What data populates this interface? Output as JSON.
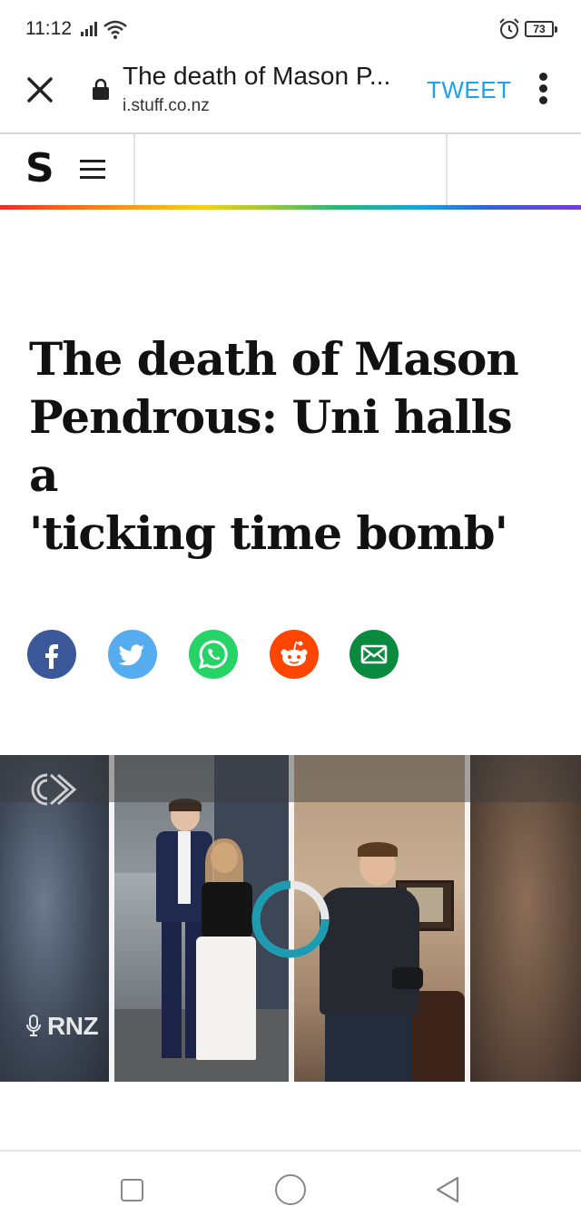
{
  "status_bar": {
    "time": "11:12",
    "battery": "73"
  },
  "toolbar": {
    "page_title": "The death of Mason P...",
    "url": "i.stuff.co.nz",
    "tweet_label": "TWEET"
  },
  "site_header": {
    "logo": "S"
  },
  "article": {
    "headline_lines": [
      "The death of Mason",
      "Pendrous: Uni halls a",
      "'ticking time bomb'"
    ]
  },
  "share_buttons": [
    {
      "network": "facebook",
      "icon": "facebook-icon",
      "color": "#3b5998"
    },
    {
      "network": "twitter",
      "icon": "twitter-icon",
      "color": "#55acee"
    },
    {
      "network": "whatsapp",
      "icon": "whatsapp-icon",
      "color": "#25d366"
    },
    {
      "network": "reddit",
      "icon": "reddit-icon",
      "color": "#ff4500"
    },
    {
      "network": "email",
      "icon": "envelope-icon",
      "color": "#0a8a3e"
    }
  ],
  "video": {
    "watermark": "RNZ",
    "state": "loading",
    "spinner_color": "#1d9bb0"
  },
  "nav_bar": {
    "buttons": [
      "recent-apps",
      "home",
      "back"
    ]
  },
  "colors": {
    "tweet": "#1da1f2",
    "accent_rainbow": [
      "#e4302c",
      "#f6a81c",
      "#8cc63f",
      "#18a6d8",
      "#7a3ccc"
    ]
  }
}
